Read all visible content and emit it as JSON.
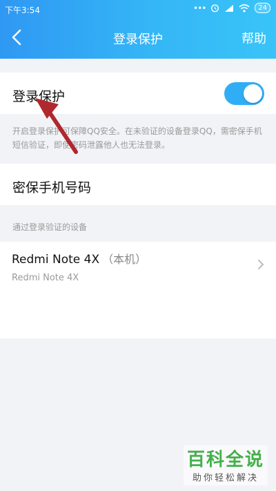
{
  "status_bar": {
    "time": "下午3:54",
    "dots": "•••",
    "battery": "24"
  },
  "nav": {
    "title": "登录保护",
    "help_label": "帮助"
  },
  "login_protect": {
    "label": "登录保护",
    "enabled": true
  },
  "note_text": "开启登录保护可保障QQ安全。在未验证的设备登录QQ，需密保手机短信验证，即使密码泄露他人也无法登录。",
  "phone_row": {
    "label": "密保手机号码"
  },
  "devices": {
    "section_label": "通过登录验证的设备",
    "items": [
      {
        "name": "Redmi Note 4X",
        "suffix": "（本机）",
        "model": "Redmi Note 4X"
      }
    ]
  },
  "watermark": {
    "main": "百科全说",
    "sub": "助你轻松解决"
  },
  "colors": {
    "accent": "#2faef5",
    "header_start": "#2f98f3",
    "header_end": "#38c4f8",
    "arrow": "#b0282f",
    "watermark": "#43b04a"
  },
  "icons": [
    "back-icon",
    "alarm-icon",
    "signal-icon",
    "wifi-icon",
    "battery-icon",
    "chevron-right-icon",
    "arrow-annotation"
  ]
}
